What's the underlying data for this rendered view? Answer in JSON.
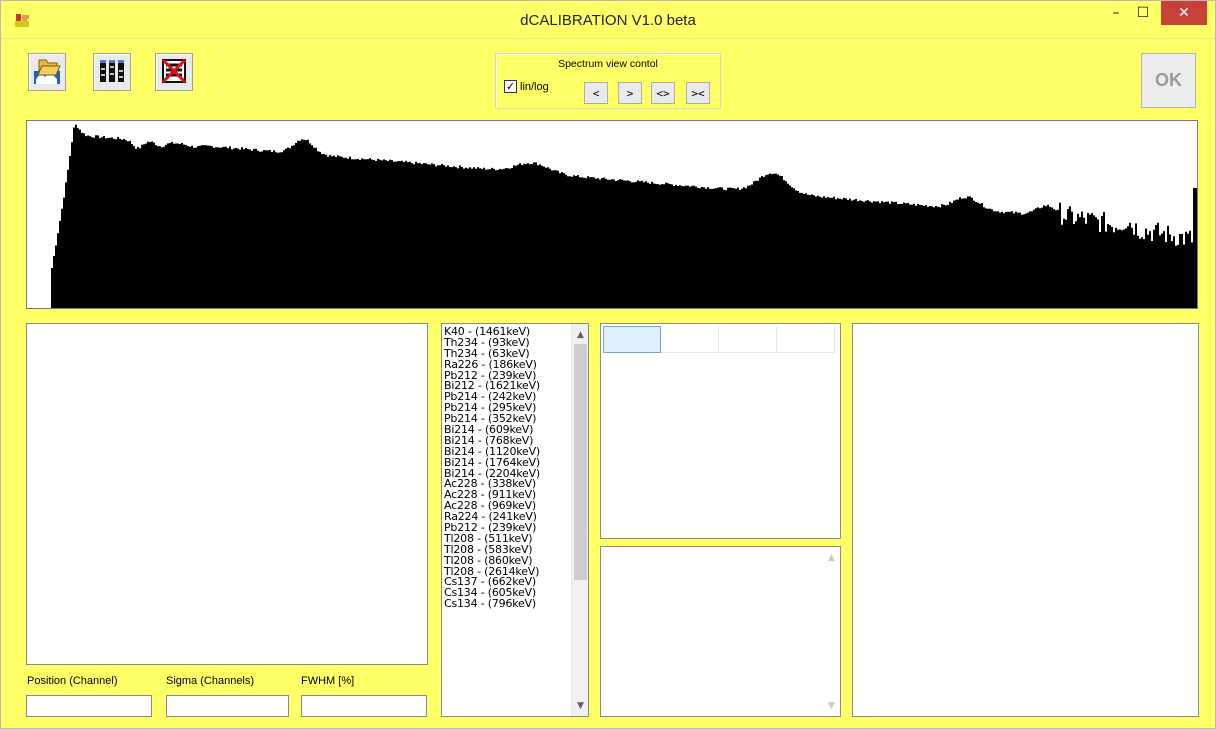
{
  "window": {
    "title": "dCALIBRATION V1.0 beta",
    "minimize": "–",
    "maximize": "☐",
    "close": "✕"
  },
  "toolbar": {
    "open_icon": "open-spectrum-icon",
    "library_icon": "isotope-library-icon",
    "clear_icon": "clear-spectrum-icon"
  },
  "spectrum_view": {
    "group_title": "Spectrum view contol",
    "lin_log_label": "lin/log",
    "lin_log_checked": true,
    "checkmark": "✓",
    "buttons": [
      "<",
      ">",
      "<>",
      "><"
    ]
  },
  "ok_button": {
    "label": "OK",
    "enabled": false
  },
  "isotope_list": [
    "K40 - (1461keV)",
    "Th234 - (93keV)",
    "Th234 - (63keV)",
    "Ra226 - (186keV)",
    "Pb212 - (239keV)",
    "Bi212 - (1621keV)",
    "Pb214 - (242keV)",
    "Pb214 - (295keV)",
    "Pb214 - (352keV)",
    "Bi214 - (609keV)",
    "Bi214 - (768keV)",
    "Bi214 - (1120keV)",
    "Bi214 - (1764keV)",
    "Bi214 - (2204keV)",
    "Ac228 - (338keV)",
    "Ac228 - (911keV)",
    "Ac228 - (969keV)",
    "Ra224 - (241keV)",
    "Pb212 - (239keV)",
    "Tl208 - (511keV)",
    "Tl208 - (583keV)",
    "Tl208 - (860keV)",
    "Tl208 - (2614keV)",
    "Cs137 - (662keV)",
    "Cs134 - (605keV)",
    "Cs134 - (796keV)"
  ],
  "fields": {
    "position_label": "Position (Channel)",
    "sigma_label": "Sigma (Channels)",
    "fwhm_label": "FWHM [%]",
    "position_value": "",
    "sigma_value": "",
    "fwhm_value": ""
  },
  "scroll": {
    "up": "▲",
    "down": "▼"
  },
  "colors": {
    "background": "#ffff66",
    "spectrum": "#000000",
    "close_button": "#c7403a"
  }
}
